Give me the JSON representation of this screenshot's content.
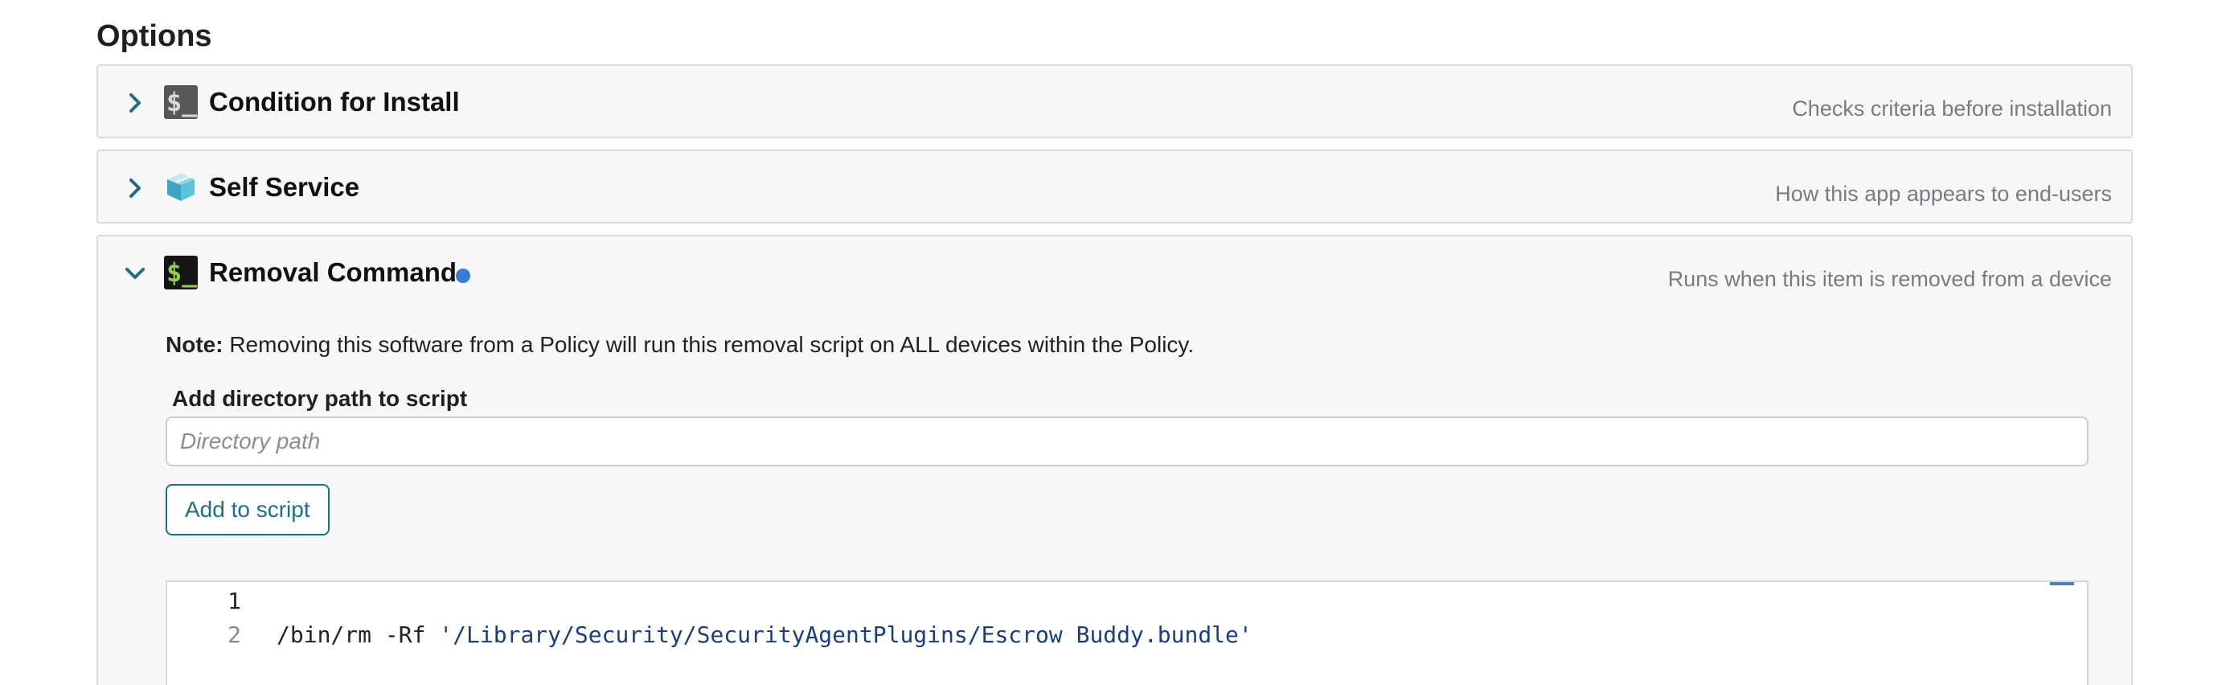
{
  "section_title": "Options",
  "panels": [
    {
      "title": "Condition for Install",
      "description": "Checks criteria before installation",
      "icon": "terminal-icon",
      "expanded": false
    },
    {
      "title": "Self Service",
      "description": "How this app appears to end-users",
      "icon": "package-box-icon",
      "expanded": false
    },
    {
      "title": "Removal Command",
      "description": "Runs when this item is removed from a device",
      "icon": "terminal-icon",
      "expanded": true,
      "modified_indicator": true
    }
  ],
  "removal": {
    "note_label": "Note:",
    "note_text": " Removing this software from a Policy will run this removal script on ALL devices within the Policy.",
    "field_label": "Add directory path to script",
    "input_value": "",
    "input_placeholder": "Directory path",
    "add_button_label": "Add to script",
    "code_lines": [
      {
        "number": "1",
        "prefix": "",
        "string": ""
      },
      {
        "number": "2",
        "prefix": "/bin/rm -Rf ",
        "string": "'/Library/Security/SecurityAgentPlugins/Escrow Buddy.bundle'"
      }
    ]
  },
  "colors": {
    "accent": "#1e6f83",
    "indicator_dot": "#3a7bd5",
    "terminal_prompt": "#8fd14f"
  }
}
